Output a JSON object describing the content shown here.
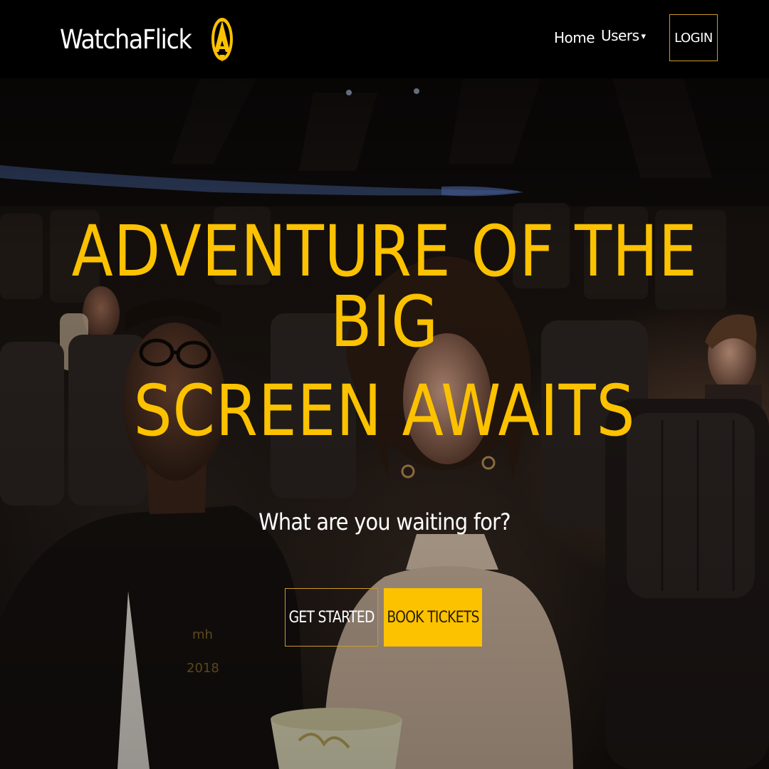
{
  "colors": {
    "accent": "#fcc200",
    "navbar_bg": "#000000",
    "text_light": "#ffffff",
    "outline": "#c99a2a"
  },
  "navbar": {
    "brand": "WatchaFlick",
    "logo_icon": "brand-logo-icon",
    "links": {
      "home": "Home",
      "users": "Users"
    },
    "users_caret": "▾",
    "login": "LOGIN"
  },
  "hero": {
    "background_image": "people watching a movie in a dark cinema",
    "headline_line1": "ADVENTURE OF THE BIG",
    "headline_line2": "SCREEN AWAITS",
    "subtitle": "What are you waiting for?",
    "buttons": {
      "get_started": "GET STARTED",
      "book_tickets": "BOOK TICKETS"
    }
  }
}
